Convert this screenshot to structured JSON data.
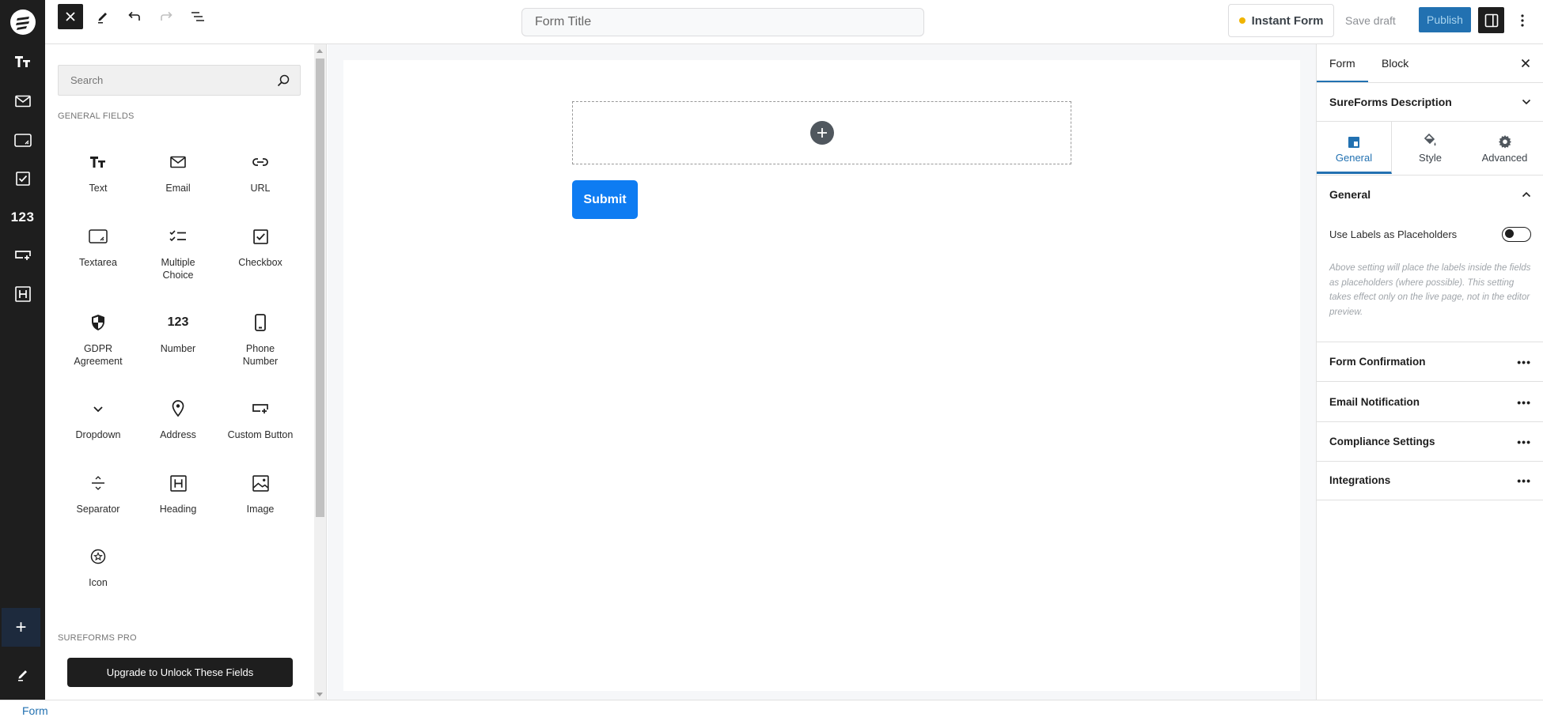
{
  "topbar": {
    "logo": "sureforms-logo",
    "close_inserter_icon": "close-icon",
    "tools_icon": "pencil-icon",
    "undo_icon": "undo-icon",
    "redo_icon": "redo-icon",
    "outline_icon": "list-view-icon",
    "form_title_placeholder": "Form Title",
    "form_title_value": "",
    "instant_form_label": "Instant Form",
    "instant_form_dot_color": "#f0b400",
    "save_draft_label": "Save draft",
    "publish_label": "Publish",
    "publish_color": "#2271b1",
    "settings_toggle_icon": "sidebar-icon",
    "more_icon": "kebab-icon"
  },
  "rail": {
    "items": [
      {
        "name": "text",
        "icon": "text-icon"
      },
      {
        "name": "email",
        "icon": "email-icon"
      },
      {
        "name": "textarea",
        "icon": "textarea-icon"
      },
      {
        "name": "checkbox",
        "icon": "checkbox-icon"
      },
      {
        "name": "number",
        "icon": "number-icon",
        "text": "123"
      },
      {
        "name": "custom-button",
        "icon": "custom-button-icon"
      },
      {
        "name": "heading",
        "icon": "heading-icon"
      }
    ],
    "add_label": "+",
    "edit_icon": "pencil-icon"
  },
  "inserter": {
    "search_placeholder": "Search",
    "general_fields_label": "GENERAL FIELDS",
    "blocks": [
      {
        "label": "Text",
        "icon": "text-icon"
      },
      {
        "label": "Email",
        "icon": "email-icon"
      },
      {
        "label": "URL",
        "icon": "link-icon"
      },
      {
        "label": "Textarea",
        "icon": "textarea-icon"
      },
      {
        "label": "Multiple Choice",
        "icon": "multiple-choice-icon"
      },
      {
        "label": "Checkbox",
        "icon": "checkbox-icon"
      },
      {
        "label": "GDPR Agreement",
        "icon": "shield-icon"
      },
      {
        "label": "Number",
        "icon": "number-icon",
        "text": "123"
      },
      {
        "label": "Phone Number",
        "icon": "phone-icon"
      },
      {
        "label": "Dropdown",
        "icon": "chevron-down-icon"
      },
      {
        "label": "Address",
        "icon": "location-pin-icon"
      },
      {
        "label": "Custom Button",
        "icon": "custom-button-icon"
      },
      {
        "label": "Separator",
        "icon": "separator-icon"
      },
      {
        "label": "Heading",
        "icon": "heading-icon"
      },
      {
        "label": "Image",
        "icon": "image-icon"
      },
      {
        "label": "Icon",
        "icon": "star-circle-icon"
      }
    ],
    "pro_label": "SUREFORMS PRO",
    "upgrade_label": "Upgrade to Unlock These Fields"
  },
  "canvas": {
    "add_block_icon": "plus-circle-icon",
    "submit_label": "Submit",
    "submit_color": "#0e7cf2"
  },
  "settings": {
    "tabs": [
      "Form",
      "Block"
    ],
    "active_tab": "Form",
    "description_label": "SureForms Description",
    "inner_tabs": [
      {
        "label": "General",
        "icon": "layout-icon"
      },
      {
        "label": "Style",
        "icon": "paint-bucket-icon"
      },
      {
        "label": "Advanced",
        "icon": "gear-icon"
      }
    ],
    "active_inner_tab": "General",
    "general_heading": "General",
    "toggle_label": "Use Labels as Placeholders",
    "toggle_on": false,
    "help_text": "Above setting will place the labels inside the fields as placeholders (where possible). This setting takes effect only on the live page, not in the editor preview.",
    "sections": [
      "Form Confirmation",
      "Email Notification",
      "Compliance Settings",
      "Integrations"
    ],
    "accent_color": "#2271b1"
  },
  "footer": {
    "breadcrumb": "Form"
  }
}
